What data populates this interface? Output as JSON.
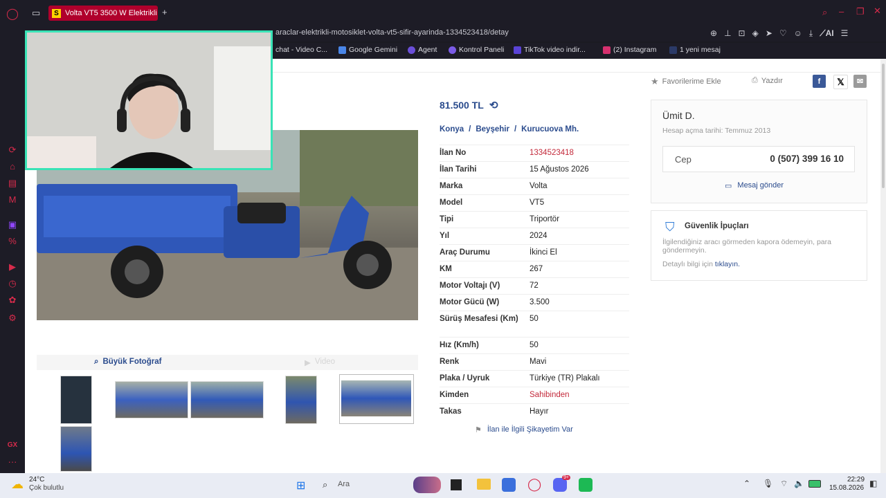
{
  "browser": {
    "tab_title": "Volta VT5 3500 W Elektrikli",
    "tab_favicon": "S",
    "new_tab": "+",
    "url": "araclar-elektrikli-motosiklet-volta-vt5-sifir-ayarinda-1334523418/detay",
    "ai_label": "AI",
    "bookmarks": [
      "chat - Video C...",
      "Google Gemini",
      "Agent",
      "Kontrol Paneli",
      "TikTok video indir...",
      "(2) Instagram",
      "1 yeni mesaj"
    ]
  },
  "actions": {
    "favorite": "Favorilerime Ekle",
    "print": "Yazdır"
  },
  "listing": {
    "price": "81.500 TL",
    "location": [
      "Konya",
      "Beyşehir",
      "Kurucuova Mh."
    ],
    "separator": "/",
    "details": [
      {
        "label": "İlan No",
        "value": "1334523418",
        "highlight": true
      },
      {
        "label": "İlan Tarihi",
        "value": "15 Ağustos 2026"
      },
      {
        "label": "Marka",
        "value": "Volta"
      },
      {
        "label": "Model",
        "value": "VT5"
      },
      {
        "label": "Tipi",
        "value": "Triportör"
      },
      {
        "label": "Yıl",
        "value": "2024"
      },
      {
        "label": "Araç Durumu",
        "value": "İkinci El"
      },
      {
        "label": "KM",
        "value": "267"
      },
      {
        "label": "Motor Voltajı (V)",
        "value": "72"
      },
      {
        "label": "Motor Gücü (W)",
        "value": "3.500"
      },
      {
        "label": "Sürüş Mesafesi (Km)",
        "value": "50"
      },
      {
        "label": "Hız (Km/h)",
        "value": "50"
      },
      {
        "label": "Renk",
        "value": "Mavi"
      },
      {
        "label": "Plaka / Uyruk",
        "value": "Türkiye (TR) Plakalı"
      },
      {
        "label": "Kimden",
        "value": "Sahibinden",
        "highlight": true
      },
      {
        "label": "Takas",
        "value": "Hayır"
      }
    ],
    "complaint": "İlan ile İlgili Şikayetim Var"
  },
  "photos": {
    "big_photo": "Büyük Fotoğraf",
    "video": "Video"
  },
  "seller": {
    "name": "Ümit D.",
    "member_since": "Hesap açma tarihi: Temmuz 2013",
    "phone_label": "Cep",
    "phone": "0 (507) 399 16 10",
    "message": "Mesaj gönder"
  },
  "safety": {
    "title": "Güvenlik İpuçları",
    "text": "İlgilendiğiniz aracı görmeden kapora ödemeyin, para göndermeyin.",
    "more_prefix": "Detaylı bilgi için",
    "more_link": "tıklayın."
  },
  "taskbar": {
    "temp": "24°C",
    "weather": "Çok bulutlu",
    "search": "Ara",
    "time": "22:29",
    "date": "15.08.2026",
    "badge": "9+"
  },
  "colors": {
    "brand_red": "#c3293a",
    "link_blue": "#2a4b8d",
    "tab_red": "#b0002c",
    "webcam_border": "#39e3b6"
  }
}
